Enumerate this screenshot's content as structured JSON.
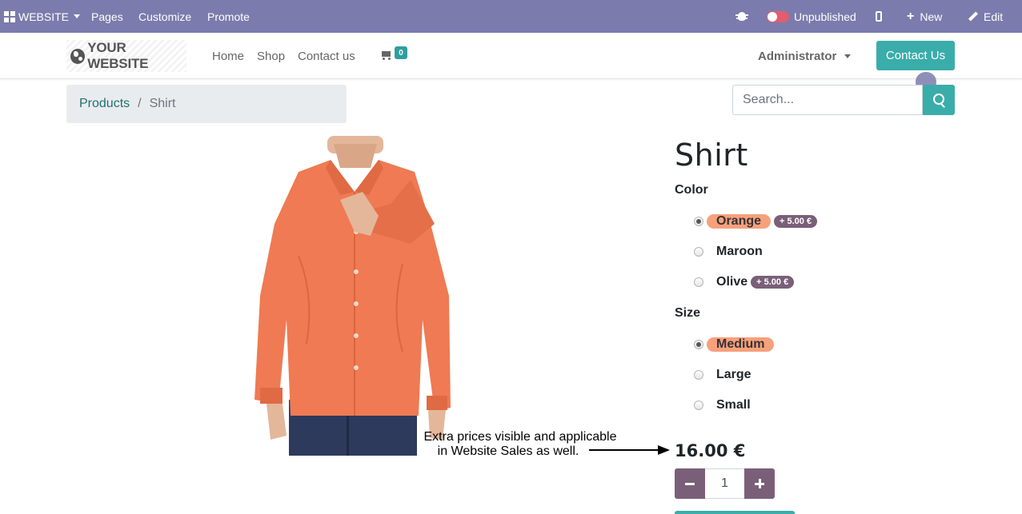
{
  "topbar": {
    "website_label": "WEBSITE",
    "pages": "Pages",
    "customize": "Customize",
    "promote": "Promote",
    "publish_status": "Unpublished",
    "new": "New",
    "edit": "Edit"
  },
  "header": {
    "logo_text": "YOUR WEBSITE",
    "nav": [
      "Home",
      "Shop",
      "Contact us"
    ],
    "cart_count": "0",
    "user": "Administrator",
    "contact_button": "Contact Us"
  },
  "breadcrumb": {
    "parent": "Products",
    "separator": "/",
    "current": "Shirt"
  },
  "search": {
    "placeholder": "Search..."
  },
  "product": {
    "name": "Shirt",
    "attributes": [
      {
        "label": "Color",
        "options": [
          {
            "name": "Orange",
            "extra": "+ 5.00 €",
            "selected": true
          },
          {
            "name": "Maroon",
            "extra": "",
            "selected": false
          },
          {
            "name": "Olive",
            "extra": "+ 5.00 €",
            "selected": false
          }
        ]
      },
      {
        "label": "Size",
        "options": [
          {
            "name": "Medium",
            "extra": "",
            "selected": true
          },
          {
            "name": "Large",
            "extra": "",
            "selected": false
          },
          {
            "name": "Small",
            "extra": "",
            "selected": false
          }
        ]
      }
    ],
    "price": "16.00 €",
    "quantity": "1"
  },
  "annotation": {
    "line1": "Extra prices visible and applicable",
    "line2": "in Website Sales as well."
  },
  "colors": {
    "edit_bar": "#7c7bad",
    "primary": "#3aadaa",
    "secondary": "#7a5f79",
    "highlight": "#f7a07c",
    "shirt": "#ef7a53"
  }
}
